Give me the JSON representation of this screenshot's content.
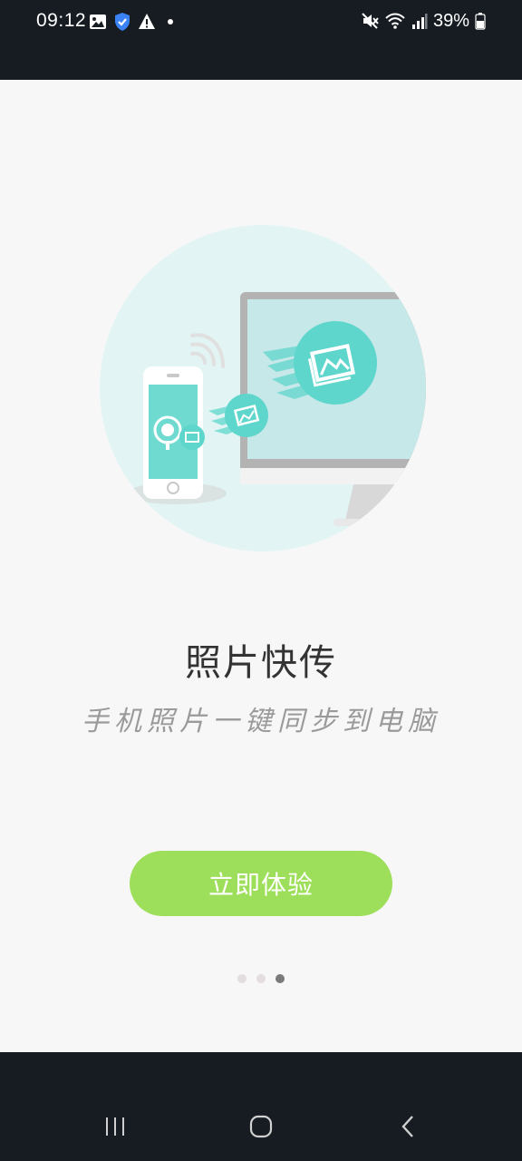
{
  "status_bar": {
    "time": "09:12",
    "battery_percent": "39%",
    "left_icons": [
      "gallery-icon",
      "shield-check-icon",
      "warning-icon",
      "dot-icon"
    ],
    "right_icons": [
      "mute-icon",
      "wifi-icon",
      "signal-icon",
      "battery-icon"
    ]
  },
  "onboarding": {
    "title": "照片快传",
    "subtitle": "手机照片一键同步到电脑",
    "cta_label": "立即体验",
    "pager": {
      "total": 3,
      "active_index": 2
    }
  },
  "colors": {
    "status_bar_bg": "#161c22",
    "page_bg": "#f7f7f7",
    "cta_bg": "#9ddf5a",
    "circle_bg": "#e2f5f4",
    "accent_teal": "#5ed6cc"
  },
  "navigation_bar": {
    "buttons": [
      "recent-apps-icon",
      "home-icon",
      "back-icon"
    ]
  }
}
